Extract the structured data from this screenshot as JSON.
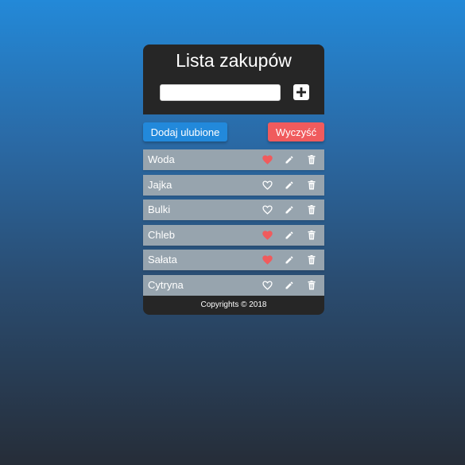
{
  "app": {
    "title": "Lista zakupów",
    "new_item_input": {
      "value": "",
      "placeholder": ""
    },
    "add_button_icon": "plus-icon"
  },
  "controls": {
    "favorites_label": "Dodaj ulubione",
    "clear_label": "Wyczyść"
  },
  "items": [
    {
      "label": "Woda",
      "favorite": true
    },
    {
      "label": "Jajka",
      "favorite": false
    },
    {
      "label": "Bulki",
      "favorite": false
    },
    {
      "label": "Chleb",
      "favorite": true
    },
    {
      "label": "Sałata",
      "favorite": true
    },
    {
      "label": "Cytryna",
      "favorite": false
    }
  ],
  "footer": {
    "text": "Copyrights © 2018"
  },
  "colors": {
    "header_bg": "#262626",
    "item_bg": "#97a4ae",
    "favorite_heart": "#f05b5d",
    "primary_button": "#2289db",
    "danger_button": "#f05b5d"
  }
}
